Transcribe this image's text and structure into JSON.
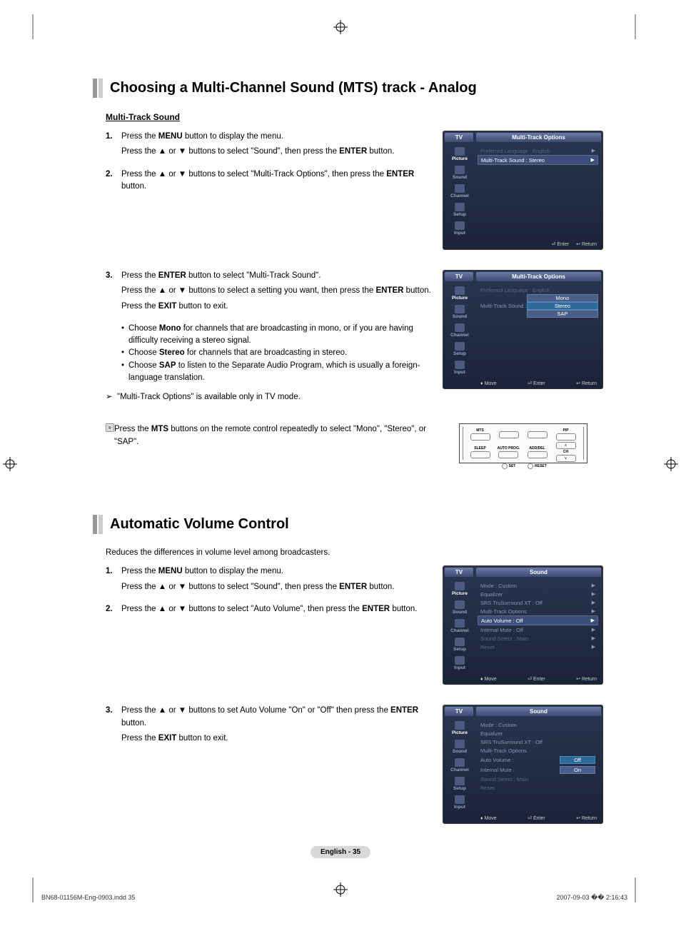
{
  "section1": {
    "title": "Choosing a Multi-Channel Sound (MTS) track - Analog",
    "subtitle": "Multi-Track Sound",
    "steps": [
      {
        "n": "1.",
        "lines": [
          "Press the <b>MENU</b> button to display the menu.",
          "Press the ▲ or ▼ buttons to select \"Sound\", then press the <b>ENTER</b> button."
        ]
      },
      {
        "n": "2.",
        "lines": [
          "Press the ▲ or ▼ buttons to select \"Multi-Track Options\", then press the <b>ENTER</b> button."
        ]
      },
      {
        "n": "3.",
        "lines": [
          "Press the <b>ENTER</b> button to select \"Multi-Track Sound\".",
          "Press the ▲ or ▼ buttons to select a setting you want, then press the <b>ENTER</b> button.",
          "Press the <b>EXIT</b> button to exit."
        ]
      }
    ],
    "bullets": [
      "Choose <b>Mono</b> for channels that are broadcasting in mono, or if you are having difficulty receiving a stereo signal.",
      "Choose <b>Stereo</b> for channels that are broadcasting in stereo.",
      "Choose <b>SAP</b> to listen to the Separate Audio Program, which is usually a foreign-language translation."
    ],
    "note1": "\"Multi-Track Options\" is available only in TV mode.",
    "note2": "Press the <b>MTS</b> buttons on the remote control repeatedly to select \"Mono\", \"Stereo\", or \"SAP\"."
  },
  "section2": {
    "title": "Automatic Volume Control",
    "intro": "Reduces the differences in volume level among broadcasters.",
    "steps": [
      {
        "n": "1.",
        "lines": [
          "Press the <b>MENU</b> button to display the menu.",
          "Press the ▲ or ▼ buttons to select \"Sound\", then press the <b>ENTER</b> button."
        ]
      },
      {
        "n": "2.",
        "lines": [
          "Press the ▲ or ▼ buttons to select \"Auto Volume\", then press the <b>ENTER</b> button."
        ]
      },
      {
        "n": "3.",
        "lines": [
          "Press the ▲ or ▼ buttons to set Auto Volume \"On\" or \"Off\" then press the <b>ENTER</b> button.",
          "Press the <b>EXIT</b> button to exit."
        ]
      }
    ]
  },
  "osd": {
    "tv": "TV",
    "sidebar": [
      "Picture",
      "Sound",
      "Channel",
      "Setup",
      "Input"
    ],
    "mto_title": "Multi-Track Options",
    "mto_rows": [
      {
        "label": "Preferred Language",
        "value": ": English",
        "dim": true
      },
      {
        "label": "Multi-Track Sound",
        "value": ": Stereo",
        "hl": true
      }
    ],
    "mto2_rows_label": "Multi-Track Sound   :",
    "mto2_pref": "Preferred Language : English",
    "mto2_opts": [
      "Mono",
      "Stereo",
      "SAP"
    ],
    "sound_title": "Sound",
    "sound_rows": [
      {
        "label": "Mode",
        "value": ": Custom"
      },
      {
        "label": "Equalizer",
        "value": ""
      },
      {
        "label": "SRS TruSurround XT",
        "value": ": Off"
      },
      {
        "label": "Multi-Track Options",
        "value": ""
      },
      {
        "label": "Auto Volume",
        "value": ": Off",
        "hl": true
      },
      {
        "label": "Internal Mute",
        "value": ": Off"
      },
      {
        "label": "Sound Select",
        "value": ": Main",
        "dim": true
      },
      {
        "label": "Reset",
        "value": "",
        "dim": true
      }
    ],
    "sound2_rows": [
      {
        "label": "Mode",
        "value": ": Custom"
      },
      {
        "label": "Equalizer",
        "value": ""
      },
      {
        "label": "SRS TruSurround XT",
        "value": ": Off"
      },
      {
        "label": "Multi-Track Options",
        "value": ""
      },
      {
        "label": "Auto Volume",
        "value": ":"
      },
      {
        "label": "Internal Mute",
        "value": ":"
      },
      {
        "label": "Sound Select",
        "value": ": Main",
        "dim": true
      },
      {
        "label": "Reset",
        "value": "",
        "dim": true
      }
    ],
    "av_opts": [
      "Off",
      "On"
    ],
    "footer_enter": "Enter",
    "footer_return": "Return",
    "footer_move": "Move"
  },
  "remote": {
    "mts": "MTS",
    "pip": "PIP",
    "sleep": "SLEEP",
    "autoprog": "AUTO PROG.",
    "adddel": "ADD/DEL",
    "ch": "CH",
    "set": "SET",
    "reset": "RESET"
  },
  "pagenum": "English - 35",
  "footer_file": "BN68-01156M-Eng-0903.indd   35",
  "footer_time": "2007-09-03   �� 2:16:43"
}
